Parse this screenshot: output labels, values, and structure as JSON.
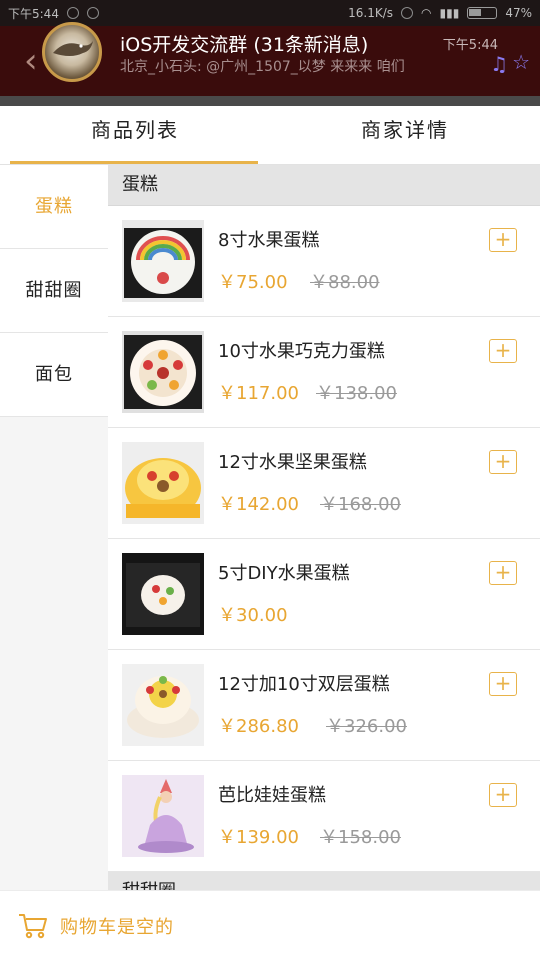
{
  "status_bar": {
    "time_left": "下午5:44",
    "net_speed": "16.1K/s",
    "battery": "47%"
  },
  "notification": {
    "title": "iOS开发交流群 (31条新消息)",
    "time": "下午5:44",
    "message": "北京_小石头: @广州_1507_以梦 来来来 咱们"
  },
  "tabs": [
    {
      "label": "商品列表",
      "active": true
    },
    {
      "label": "商家详情",
      "active": false
    }
  ],
  "categories": [
    {
      "label": "蛋糕",
      "active": true
    },
    {
      "label": "甜甜圈",
      "active": false
    },
    {
      "label": "面包",
      "active": false
    }
  ],
  "sections": [
    {
      "title": "蛋糕",
      "items": [
        {
          "name": "8寸水果蛋糕",
          "price": "￥75.00",
          "old_price": "￥88.00"
        },
        {
          "name": "10寸水果巧克力蛋糕",
          "price": "￥117.00",
          "old_price": "￥138.00"
        },
        {
          "name": "12寸水果坚果蛋糕",
          "price": "￥142.00",
          "old_price": "￥168.00"
        },
        {
          "name": "5寸DIY水果蛋糕",
          "price": "￥30.00",
          "old_price": ""
        },
        {
          "name": "12寸加10寸双层蛋糕",
          "price": "￥286.80",
          "old_price": "￥326.00"
        },
        {
          "name": "芭比娃娃蛋糕",
          "price": "￥139.00",
          "old_price": "￥158.00"
        }
      ]
    },
    {
      "title": "甜甜圈",
      "items": []
    }
  ],
  "add_button_label": "+",
  "cart": {
    "empty_label": "购物车是空的"
  },
  "colors": {
    "accent": "#e8a632",
    "header_bg": "#3a0c0c"
  }
}
